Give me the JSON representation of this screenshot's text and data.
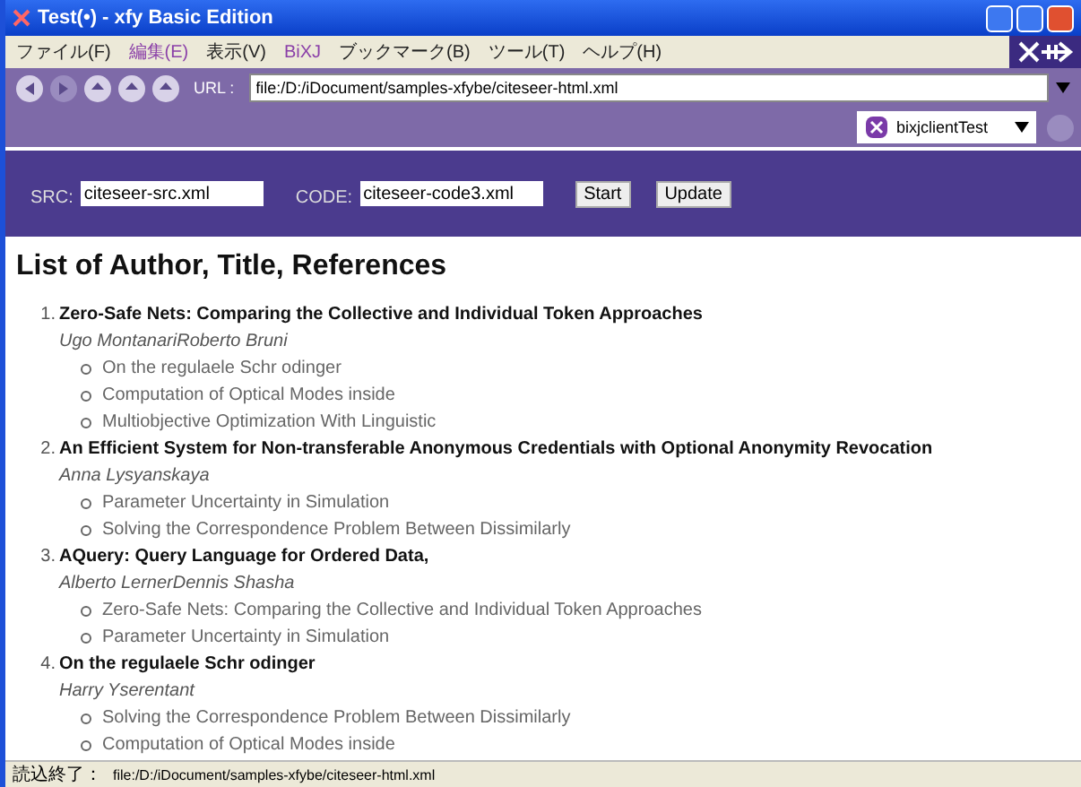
{
  "window": {
    "title": "Test(•) - xfy Basic Edition"
  },
  "menu": [
    {
      "label": "ファイル(F)",
      "highlighted": false
    },
    {
      "label": "編集(E)",
      "highlighted": true
    },
    {
      "label": "表示(V)",
      "highlighted": false
    },
    {
      "label": "BiXJ",
      "highlighted": true
    },
    {
      "label": "ブックマーク(B)",
      "highlighted": false
    },
    {
      "label": "ツール(T)",
      "highlighted": false
    },
    {
      "label": "ヘルプ(H)",
      "highlighted": false
    }
  ],
  "url_bar": {
    "label": "URL :",
    "value": "file:/D:/iDocument/samples-xfybe/citeseer-html.xml"
  },
  "profile": {
    "name": "bixjclientTest"
  },
  "form": {
    "src_label": "SRC:",
    "src_value": "citeseer-src.xml",
    "code_label": "CODE:",
    "code_value": "citeseer-code3.xml",
    "buttons": [
      "Start",
      "Update"
    ]
  },
  "content": {
    "heading": "List of Author, Title, References",
    "entries": [
      {
        "number": "1.",
        "title": "Zero-Safe Nets: Comparing the Collective and Individual Token Approaches",
        "authors": "Ugo MontanariRoberto Bruni",
        "references": [
          "On the regulaele Schr odinger",
          "Computation of Optical Modes inside",
          "Multiobjective Optimization With Linguistic"
        ]
      },
      {
        "number": "2.",
        "title": "An Efficient System for Non-transferable Anonymous Credentials with Optional Anonymity Revocation",
        "authors": "Anna Lysyanskaya",
        "references": [
          "Parameter Uncertainty in Simulation",
          "Solving the Correspondence Problem Between Dissimilarly"
        ]
      },
      {
        "number": "3.",
        "title": "AQuery: Query Language for Ordered Data,",
        "authors": "Alberto LernerDennis Shasha",
        "references": [
          "Zero-Safe Nets: Comparing the Collective and Individual Token Approaches",
          "Parameter Uncertainty in Simulation"
        ]
      },
      {
        "number": "4.",
        "title": "On the regulaele Schr odinger",
        "authors": "Harry Yserentant",
        "references": [
          "Solving the Correspondence Problem Between Dissimilarly",
          "Computation of Optical Modes inside"
        ]
      }
    ]
  },
  "status_bar": {
    "label": "読込終了：",
    "path": "file:/D:/iDocument/samples-xfybe/citeseer-html.xml"
  }
}
